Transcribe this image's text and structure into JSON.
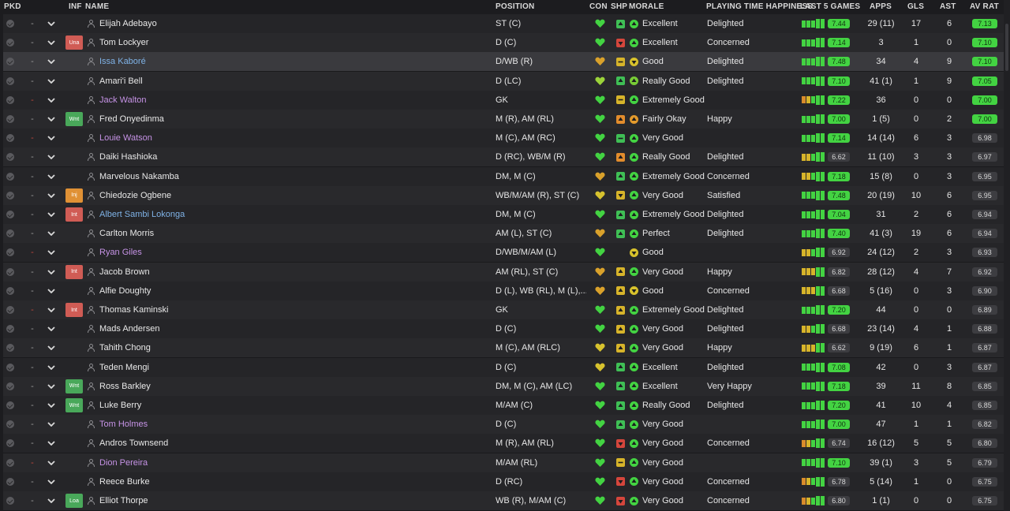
{
  "columns": {
    "pkd": "PKD",
    "inf": "INF",
    "name": "NAME",
    "position": "POSITION",
    "con": "CON",
    "shp": "SHP",
    "morale": "MORALE",
    "pth": "PLAYING TIME HAPPINESS",
    "last5": "LAST 5 GAMES",
    "apps": "APPS",
    "gls": "GLS",
    "ast": "AST",
    "avrat": "AV RAT"
  },
  "players": [
    {
      "name": "Elijah Adebayo",
      "name_color": "white",
      "inf": "",
      "pos": "ST (C)",
      "con": "green",
      "shp": "green",
      "shp_dir": "up",
      "morale": "Excellent",
      "morale_color": "#43d342",
      "morale_dir": "up",
      "pth": "Delighted",
      "form": [
        "#43d342",
        "#43d342",
        "#43d342",
        "#43d342",
        "#43d342"
      ],
      "last5": "7.44",
      "last5_color": "green",
      "apps": "29 (11)",
      "gls": "17",
      "ast": "6",
      "avrat": "7.13",
      "avrat_color": "green",
      "dash_red": false
    },
    {
      "name": "Tom Lockyer",
      "name_color": "white",
      "inf": "Una",
      "inf_color": "#d05c55",
      "pos": "D (C)",
      "con": "green",
      "shp": "red",
      "shp_dir": "down",
      "morale": "Excellent",
      "morale_color": "#43d342",
      "morale_dir": "up",
      "pth": "Concerned",
      "form": [
        "#43d342",
        "#43d342",
        "#43d342",
        "#43d342",
        "#43d342"
      ],
      "last5": "7.14",
      "last5_color": "green",
      "apps": "3",
      "gls": "1",
      "ast": "0",
      "avrat": "7.10",
      "avrat_color": "green",
      "dash_red": false
    },
    {
      "name": "Issa Kaboré",
      "name_color": "blue",
      "inf": "",
      "pos": "D/WB (R)",
      "con": "amber",
      "shp": "amber",
      "shp_dir": "flat",
      "morale": "Good",
      "morale_color": "#d8c22c",
      "morale_dir": "down",
      "pth": "Delighted",
      "form": [
        "#43d342",
        "#43d342",
        "#43d342",
        "#43d342",
        "#43d342"
      ],
      "last5": "7.48",
      "last5_color": "green",
      "apps": "34",
      "gls": "4",
      "ast": "9",
      "avrat": "7.10",
      "avrat_color": "green",
      "dash_red": false
    },
    {
      "name": "Amari'i Bell",
      "name_color": "white",
      "inf": "",
      "pos": "D (LC)",
      "con": "lime",
      "shp": "green",
      "shp_dir": "up",
      "morale": "Really Good",
      "morale_color": "#78cc36",
      "morale_dir": "up",
      "pth": "Delighted",
      "form": [
        "#43d342",
        "#43d342",
        "#43d342",
        "#43d342",
        "#43d342"
      ],
      "last5": "7.10",
      "last5_color": "green",
      "apps": "41 (1)",
      "gls": "1",
      "ast": "9",
      "avrat": "7.05",
      "avrat_color": "green",
      "dash_red": false
    },
    {
      "name": "Jack Walton",
      "name_color": "purple",
      "inf": "",
      "pos": "GK",
      "con": "green",
      "shp": "amber",
      "shp_dir": "flat",
      "morale": "Extremely Good",
      "morale_color": "#43d342",
      "morale_dir": "up",
      "pth": "",
      "form": [
        "#d98c2b",
        "#d7b42a",
        "#43d342",
        "#43d342",
        "#43d342"
      ],
      "last5": "7.22",
      "last5_color": "green",
      "apps": "36",
      "gls": "0",
      "ast": "0",
      "avrat": "7.00",
      "avrat_color": "green",
      "dash_red": true
    },
    {
      "name": "Fred Onyedinma",
      "name_color": "white",
      "inf": "Wnt",
      "inf_color": "#49a85a",
      "pos": "M (R), AM (RL)",
      "con": "green",
      "shp": "orange",
      "shp_dir": "up",
      "morale": "Fairly Okay",
      "morale_color": "#e39a2c",
      "morale_dir": "up",
      "pth": "Happy",
      "form": [
        "#43d342",
        "#43d342",
        "#43d342",
        "#43d342",
        "#43d342"
      ],
      "last5": "7.00",
      "last5_color": "green",
      "apps": "1 (5)",
      "gls": "0",
      "ast": "2",
      "avrat": "7.00",
      "avrat_color": "green",
      "dash_red": false
    },
    {
      "name": "Louie Watson",
      "name_color": "purple",
      "inf": "",
      "pos": "M (C), AM (RC)",
      "con": "green",
      "shp": "green",
      "shp_dir": "flat",
      "morale": "Very Good",
      "morale_color": "#43d342",
      "morale_dir": "up",
      "pth": "",
      "form": [
        "#43d342",
        "#43d342",
        "#43d342",
        "#43d342",
        "#43d342"
      ],
      "last5": "7.14",
      "last5_color": "green",
      "apps": "14 (14)",
      "gls": "6",
      "ast": "3",
      "avrat": "6.98",
      "avrat_color": "grey",
      "dash_red": true
    },
    {
      "name": "Daiki Hashioka",
      "name_color": "white",
      "inf": "",
      "pos": "D (RC), WB/M (R)",
      "con": "green",
      "shp": "orange",
      "shp_dir": "up",
      "morale": "Really Good",
      "morale_color": "#43d342",
      "morale_dir": "up",
      "pth": "Delighted",
      "form": [
        "#d7b42a",
        "#d7b42a",
        "#43d342",
        "#43d342",
        "#43d342"
      ],
      "last5": "6.62",
      "last5_color": "grey",
      "apps": "11 (10)",
      "gls": "3",
      "ast": "3",
      "avrat": "6.97",
      "avrat_color": "grey",
      "dash_red": false
    },
    {
      "name": "Marvelous Nakamba",
      "name_color": "white",
      "inf": "",
      "pos": "DM, M (C)",
      "con": "amber",
      "shp": "green",
      "shp_dir": "up",
      "morale": "Extremely Good",
      "morale_color": "#43d342",
      "morale_dir": "up",
      "pth": "Concerned",
      "form": [
        "#d7b42a",
        "#d7b42a",
        "#43d342",
        "#43d342",
        "#43d342"
      ],
      "last5": "7.18",
      "last5_color": "green",
      "apps": "15 (8)",
      "gls": "0",
      "ast": "3",
      "avrat": "6.95",
      "avrat_color": "grey",
      "dash_red": false
    },
    {
      "name": "Chiedozie Ogbene",
      "name_color": "white",
      "inf": "Inj",
      "inf_color": "#e09135",
      "pos": "WB/M/AM (R), ST (C)",
      "con": "yellow",
      "shp": "amber",
      "shp_dir": "down",
      "morale": "Very Good",
      "morale_color": "#43d342",
      "morale_dir": "up",
      "pth": "Satisfied",
      "form": [
        "#43d342",
        "#43d342",
        "#43d342",
        "#43d342",
        "#43d342"
      ],
      "last5": "7.48",
      "last5_color": "green",
      "apps": "20 (19)",
      "gls": "10",
      "ast": "6",
      "avrat": "6.95",
      "avrat_color": "grey",
      "dash_red": false
    },
    {
      "name": "Albert Sambi Lokonga",
      "name_color": "blue",
      "inf": "Int",
      "inf_color": "#d05c55",
      "pos": "DM, M (C)",
      "con": "green",
      "shp": "green",
      "shp_dir": "up",
      "morale": "Extremely Good",
      "morale_color": "#43d342",
      "morale_dir": "up",
      "pth": "Delighted",
      "form": [
        "#43d342",
        "#43d342",
        "#43d342",
        "#43d342",
        "#43d342"
      ],
      "last5": "7.04",
      "last5_color": "green",
      "apps": "31",
      "gls": "2",
      "ast": "6",
      "avrat": "6.94",
      "avrat_color": "grey",
      "dash_red": false
    },
    {
      "name": "Carlton Morris",
      "name_color": "white",
      "inf": "",
      "pos": "AM (L), ST (C)",
      "con": "amber",
      "shp": "green",
      "shp_dir": "up",
      "morale": "Perfect",
      "morale_color": "#43d342",
      "morale_dir": "up",
      "pth": "Delighted",
      "form": [
        "#43d342",
        "#43d342",
        "#43d342",
        "#43d342",
        "#43d342"
      ],
      "last5": "7.40",
      "last5_color": "green",
      "apps": "41 (3)",
      "gls": "19",
      "ast": "6",
      "avrat": "6.94",
      "avrat_color": "grey",
      "dash_red": false
    },
    {
      "name": "Ryan Giles",
      "name_color": "purple",
      "inf": "",
      "pos": "D/WB/M/AM (L)",
      "con": "green",
      "shp": "",
      "shp_dir": "",
      "morale": "Good",
      "morale_color": "#d8c22c",
      "morale_dir": "down",
      "pth": "",
      "form": [
        "#d7b42a",
        "#d7b42a",
        "#43d342",
        "#43d342",
        "#43d342"
      ],
      "last5": "6.92",
      "last5_color": "grey",
      "apps": "24 (12)",
      "gls": "2",
      "ast": "3",
      "avrat": "6.93",
      "avrat_color": "grey",
      "dash_red": true
    },
    {
      "name": "Jacob Brown",
      "name_color": "white",
      "inf": "Int",
      "inf_color": "#d05c55",
      "pos": "AM (RL), ST (C)",
      "con": "amber",
      "shp": "amber",
      "shp_dir": "up",
      "morale": "Very Good",
      "morale_color": "#43d342",
      "morale_dir": "up",
      "pth": "Happy",
      "form": [
        "#d7b42a",
        "#d7b42a",
        "#d7b42a",
        "#43d342",
        "#43d342"
      ],
      "last5": "6.82",
      "last5_color": "grey",
      "apps": "28 (12)",
      "gls": "4",
      "ast": "7",
      "avrat": "6.92",
      "avrat_color": "grey",
      "dash_red": false
    },
    {
      "name": "Alfie Doughty",
      "name_color": "white",
      "inf": "",
      "pos": "D (L), WB (RL), M (L),...",
      "con": "amber",
      "shp": "amber",
      "shp_dir": "up",
      "morale": "Good",
      "morale_color": "#d8c22c",
      "morale_dir": "down",
      "pth": "Concerned",
      "form": [
        "#d7b42a",
        "#d7b42a",
        "#d7b42a",
        "#43d342",
        "#43d342"
      ],
      "last5": "6.68",
      "last5_color": "grey",
      "apps": "5 (16)",
      "gls": "0",
      "ast": "3",
      "avrat": "6.90",
      "avrat_color": "grey",
      "dash_red": false
    },
    {
      "name": "Thomas Kaminski",
      "name_color": "white",
      "inf": "Int",
      "inf_color": "#d05c55",
      "pos": "GK",
      "con": "green",
      "shp": "amber",
      "shp_dir": "up",
      "morale": "Extremely Good",
      "morale_color": "#43d342",
      "morale_dir": "up",
      "pth": "Delighted",
      "form": [
        "#43d342",
        "#43d342",
        "#43d342",
        "#43d342",
        "#43d342"
      ],
      "last5": "7.20",
      "last5_color": "green",
      "apps": "44",
      "gls": "0",
      "ast": "0",
      "avrat": "6.89",
      "avrat_color": "grey",
      "dash_red": true
    },
    {
      "name": "Mads Andersen",
      "name_color": "white",
      "inf": "",
      "pos": "D (C)",
      "con": "green",
      "shp": "amber",
      "shp_dir": "up",
      "morale": "Very Good",
      "morale_color": "#43d342",
      "morale_dir": "up",
      "pth": "Delighted",
      "form": [
        "#d7b42a",
        "#d7b42a",
        "#43d342",
        "#43d342",
        "#43d342"
      ],
      "last5": "6.68",
      "last5_color": "grey",
      "apps": "23 (14)",
      "gls": "4",
      "ast": "1",
      "avrat": "6.88",
      "avrat_color": "grey",
      "dash_red": false
    },
    {
      "name": "Tahith Chong",
      "name_color": "white",
      "inf": "",
      "pos": "M (C), AM (RLC)",
      "con": "yellow",
      "shp": "amber",
      "shp_dir": "up",
      "morale": "Very Good",
      "morale_color": "#43d342",
      "morale_dir": "up",
      "pth": "Happy",
      "form": [
        "#d7b42a",
        "#d7b42a",
        "#d7b42a",
        "#43d342",
        "#43d342"
      ],
      "last5": "6.62",
      "last5_color": "grey",
      "apps": "9 (19)",
      "gls": "6",
      "ast": "1",
      "avrat": "6.87",
      "avrat_color": "grey",
      "dash_red": false
    },
    {
      "name": "Teden Mengi",
      "name_color": "white",
      "inf": "",
      "pos": "D (C)",
      "con": "yellow",
      "shp": "green",
      "shp_dir": "up",
      "morale": "Excellent",
      "morale_color": "#43d342",
      "morale_dir": "up",
      "pth": "Delighted",
      "form": [
        "#43d342",
        "#43d342",
        "#43d342",
        "#43d342",
        "#43d342"
      ],
      "last5": "7.08",
      "last5_color": "green",
      "apps": "42",
      "gls": "0",
      "ast": "3",
      "avrat": "6.87",
      "avrat_color": "grey",
      "dash_red": false
    },
    {
      "name": "Ross Barkley",
      "name_color": "white",
      "inf": "Wnt",
      "inf_color": "#49a85a",
      "pos": "DM, M (C), AM (LC)",
      "con": "green",
      "shp": "green",
      "shp_dir": "up",
      "morale": "Excellent",
      "morale_color": "#43d342",
      "morale_dir": "up",
      "pth": "Very Happy",
      "form": [
        "#43d342",
        "#43d342",
        "#43d342",
        "#43d342",
        "#43d342"
      ],
      "last5": "7.18",
      "last5_color": "green",
      "apps": "39",
      "gls": "11",
      "ast": "8",
      "avrat": "6.85",
      "avrat_color": "grey",
      "dash_red": false
    },
    {
      "name": "Luke Berry",
      "name_color": "white",
      "inf": "Wnt",
      "inf_color": "#49a85a",
      "pos": "M/AM (C)",
      "con": "green",
      "shp": "green",
      "shp_dir": "up",
      "morale": "Really Good",
      "morale_color": "#43d342",
      "morale_dir": "up",
      "pth": "Delighted",
      "form": [
        "#43d342",
        "#43d342",
        "#43d342",
        "#43d342",
        "#43d342"
      ],
      "last5": "7.20",
      "last5_color": "green",
      "apps": "41",
      "gls": "10",
      "ast": "4",
      "avrat": "6.85",
      "avrat_color": "grey",
      "dash_red": false
    },
    {
      "name": "Tom Holmes",
      "name_color": "purple",
      "inf": "",
      "pos": "D (C)",
      "con": "green",
      "shp": "green",
      "shp_dir": "up",
      "morale": "Very Good",
      "morale_color": "#43d342",
      "morale_dir": "up",
      "pth": "",
      "form": [
        "#43d342",
        "#43d342",
        "#43d342",
        "#43d342",
        "#43d342"
      ],
      "last5": "7.00",
      "last5_color": "green",
      "apps": "47",
      "gls": "1",
      "ast": "1",
      "avrat": "6.82",
      "avrat_color": "grey",
      "dash_red": false
    },
    {
      "name": "Andros Townsend",
      "name_color": "white",
      "inf": "",
      "pos": "M (R), AM (RL)",
      "con": "green",
      "shp": "red",
      "shp_dir": "down",
      "morale": "Very Good",
      "morale_color": "#43d342",
      "morale_dir": "up",
      "pth": "Concerned",
      "form": [
        "#d98c2b",
        "#d7b42a",
        "#43d342",
        "#43d342",
        "#43d342"
      ],
      "last5": "6.74",
      "last5_color": "grey",
      "apps": "16 (12)",
      "gls": "5",
      "ast": "5",
      "avrat": "6.80",
      "avrat_color": "grey",
      "dash_red": false
    },
    {
      "name": "Dion Pereira",
      "name_color": "purple",
      "inf": "",
      "pos": "M/AM (RL)",
      "con": "green",
      "shp": "amber",
      "shp_dir": "flat",
      "morale": "Very Good",
      "morale_color": "#43d342",
      "morale_dir": "up",
      "pth": "",
      "form": [
        "#43d342",
        "#43d342",
        "#43d342",
        "#43d342",
        "#43d342"
      ],
      "last5": "7.10",
      "last5_color": "green",
      "apps": "39 (1)",
      "gls": "3",
      "ast": "5",
      "avrat": "6.79",
      "avrat_color": "grey",
      "dash_red": true
    },
    {
      "name": "Reece Burke",
      "name_color": "white",
      "inf": "",
      "pos": "D (RC)",
      "con": "green",
      "shp": "red",
      "shp_dir": "down",
      "morale": "Very Good",
      "morale_color": "#43d342",
      "morale_dir": "up",
      "pth": "Concerned",
      "form": [
        "#d98c2b",
        "#d7b42a",
        "#43d342",
        "#43d342",
        "#43d342"
      ],
      "last5": "6.78",
      "last5_color": "grey",
      "apps": "5 (14)",
      "gls": "1",
      "ast": "0",
      "avrat": "6.75",
      "avrat_color": "grey",
      "dash_red": false
    },
    {
      "name": "Elliot Thorpe",
      "name_color": "white",
      "inf": "Loa",
      "inf_color": "#49a85a",
      "pos": "WB (R), M/AM (C)",
      "con": "green",
      "shp": "red",
      "shp_dir": "down",
      "morale": "Very Good",
      "morale_color": "#43d342",
      "morale_dir": "up",
      "pth": "Concerned",
      "form": [
        "#d98c2b",
        "#d7b42a",
        "#43d342",
        "#43d342",
        "#43d342"
      ],
      "last5": "6.80",
      "last5_color": "grey",
      "apps": "1 (1)",
      "gls": "0",
      "ast": "0",
      "avrat": "6.75",
      "avrat_color": "grey",
      "dash_red": false
    }
  ]
}
